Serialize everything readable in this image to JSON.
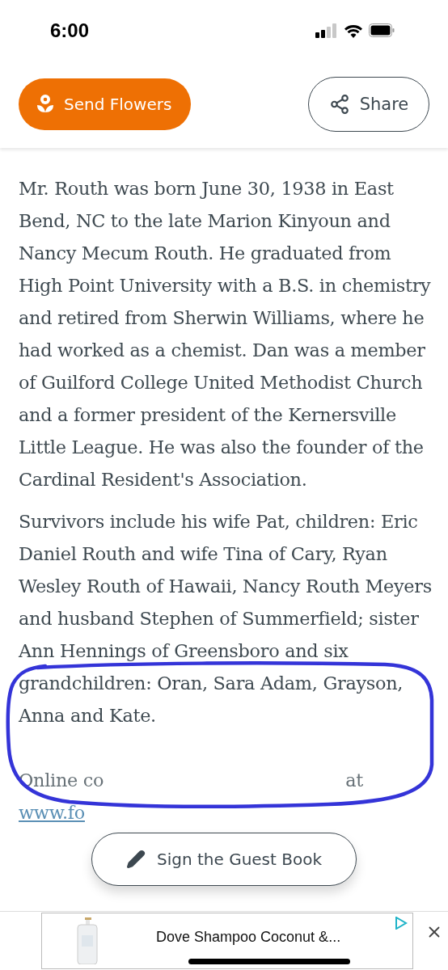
{
  "status_bar": {
    "time": "6:00"
  },
  "header": {
    "send_flowers": "Send Flowers",
    "share": "Share"
  },
  "obituary": {
    "paragraphs": [
      "Mr. Routh was born June 30, 1938 in East Bend, NC to the late Marion Kinyoun and Nancy Mecum Routh. He graduated from High Point University with a B.S. in chemistry and retired from Sherwin Williams, where he had worked as a chemist. Dan was a member of Guilford College United Methodist Church and a former president of the Kernersville Little League. He was also the founder of the Cardinal Resident's Association.",
      "Survivors include his wife Pat, children: Eric Daniel Routh and wife Tina of Cary, Ryan Wesley Routh of Hawaii, Nancy Routh Meyers and husband Stephen of Summerfield; sister Ann Hennings of Greensboro and six grandchildren: Oran, Sara Adam, Grayson, Anna and Kate."
    ],
    "condolences_start": "Online co",
    "condolences_end": "at",
    "link": "www.fo"
  },
  "guest_book_button": "Sign the Guest Book",
  "ad": {
    "title": "Dove Shampoo Coconut &..."
  }
}
